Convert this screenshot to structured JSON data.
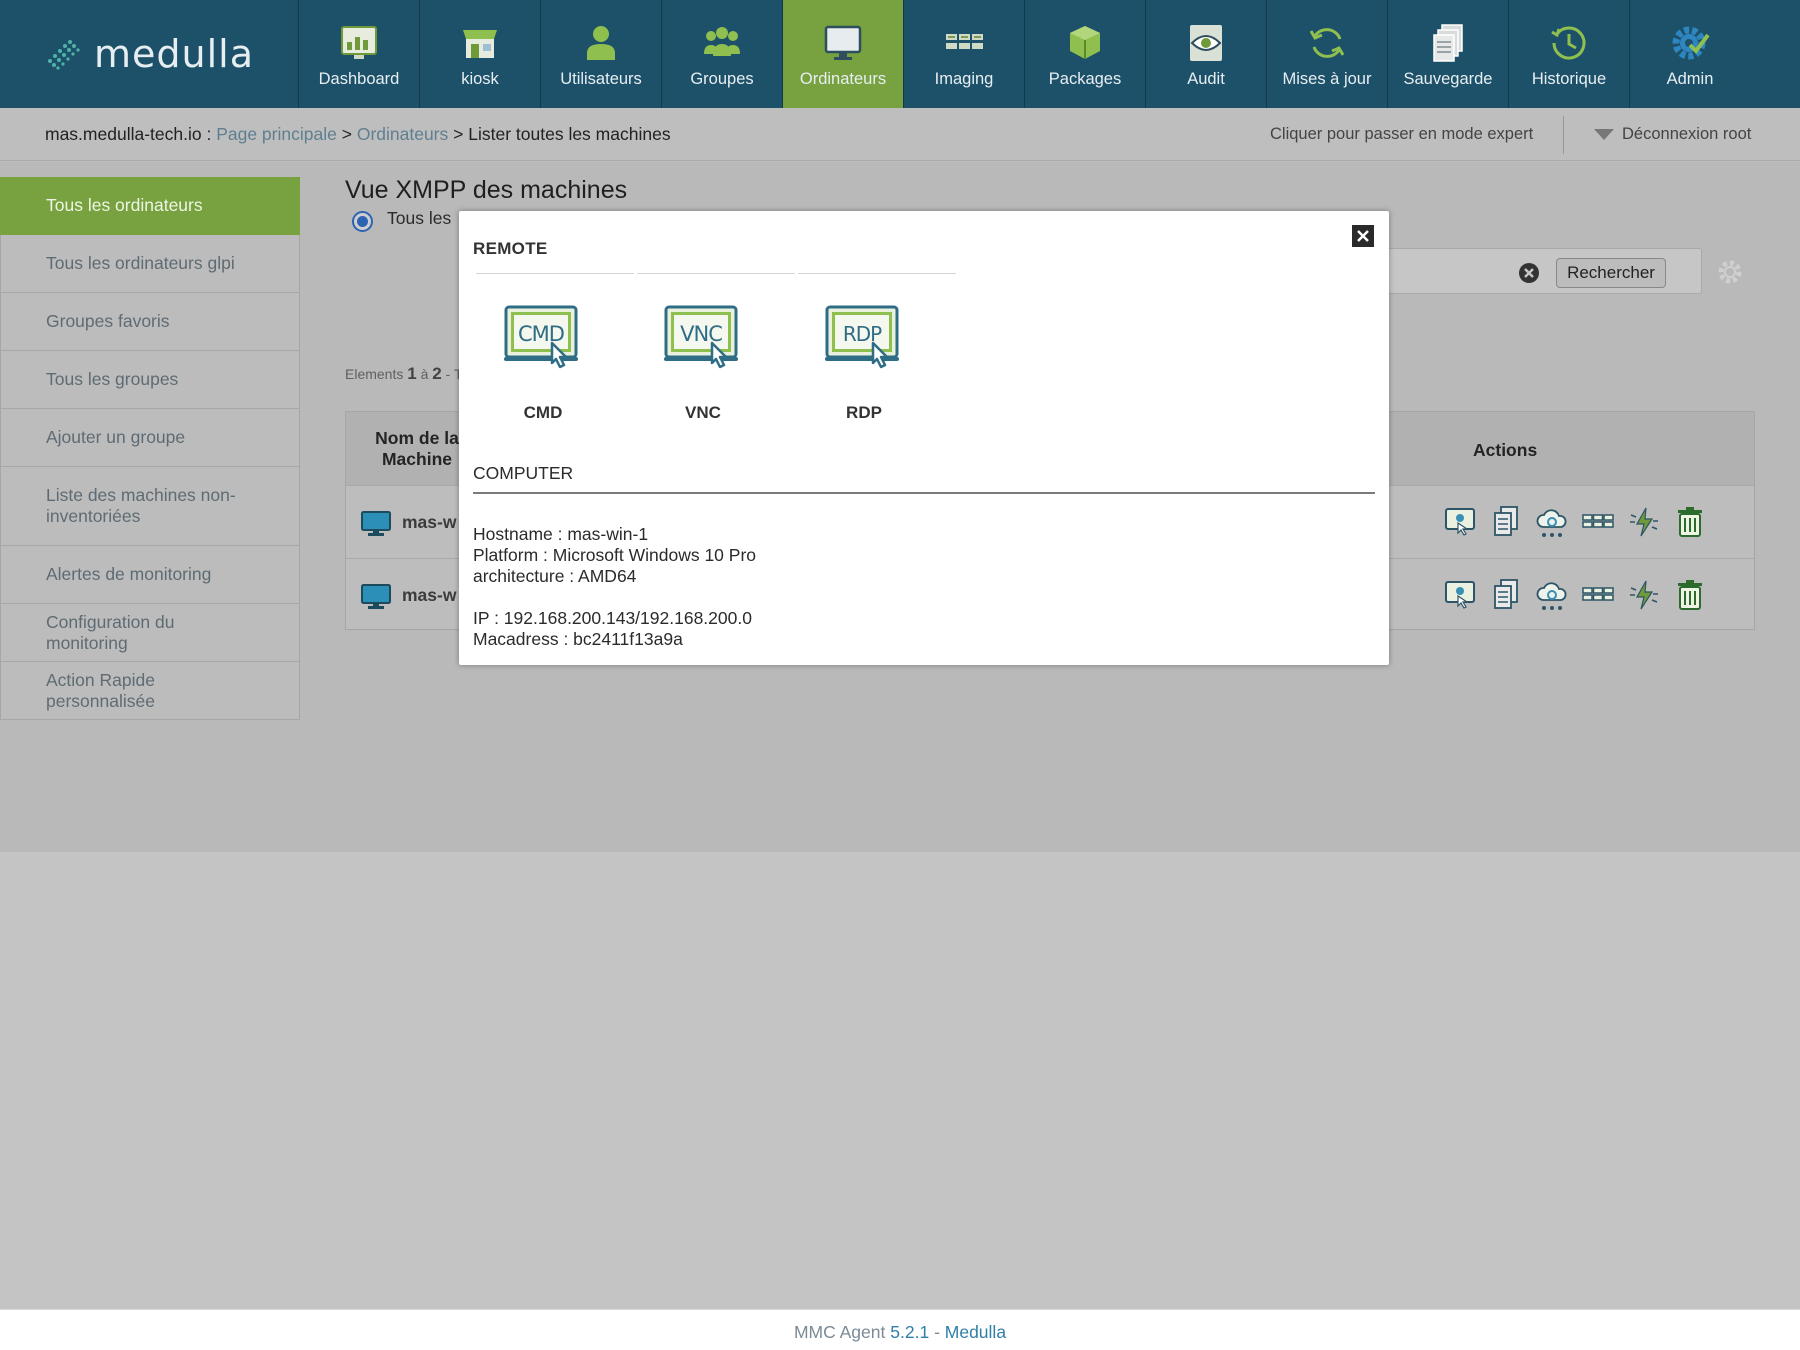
{
  "app": {
    "logo_text": "medulla"
  },
  "nav": [
    {
      "label": "Dashboard",
      "icon": "dashboard-icon"
    },
    {
      "label": "kiosk",
      "icon": "kiosk-icon"
    },
    {
      "label": "Utilisateurs",
      "icon": "user-icon"
    },
    {
      "label": "Groupes",
      "icon": "group-icon"
    },
    {
      "label": "Ordinateurs",
      "icon": "monitor-icon",
      "active": true
    },
    {
      "label": "Imaging",
      "icon": "imaging-icon"
    },
    {
      "label": "Packages",
      "icon": "packages-icon"
    },
    {
      "label": "Audit",
      "icon": "audit-eye-icon"
    },
    {
      "label": "Mises à jour",
      "icon": "refresh-icon"
    },
    {
      "label": "Sauvegarde",
      "icon": "backup-icon"
    },
    {
      "label": "Historique",
      "icon": "history-icon"
    },
    {
      "label": "Admin",
      "icon": "gear-check-icon"
    }
  ],
  "breadcrumb": {
    "host": "mas.medulla-tech.io :",
    "home": "Page principale",
    "sep": ">",
    "section": "Ordinateurs",
    "current": "Lister toutes les machines"
  },
  "header": {
    "expert_mode": "Cliquer pour passer en mode expert",
    "logout": "Déconnexion root"
  },
  "sidebar": {
    "items": [
      {
        "label": "Tous les ordinateurs",
        "active": true
      },
      {
        "label": "Tous les ordinateurs glpi"
      },
      {
        "label": "Groupes favoris"
      },
      {
        "label": "Tous les groupes"
      },
      {
        "label": "Ajouter un groupe"
      },
      {
        "label": "Liste des machines non-inventoriées"
      },
      {
        "label": "Alertes de monitoring"
      },
      {
        "label": "Configuration du monitoring"
      },
      {
        "label": "Action Rapide personnalisée"
      }
    ]
  },
  "main": {
    "title": "Vue XMPP des machines",
    "radio_label": "Tous les",
    "search_button": "Rechercher",
    "elements": {
      "prefix": "Elements",
      "from": "1",
      "sep": "à",
      "to": "2",
      "suffix": "- T"
    },
    "table": {
      "header_name": "Nom de la Machine",
      "header_actions": "Actions",
      "rows": [
        {
          "name": "mas-w"
        },
        {
          "name": "mas-w"
        }
      ]
    }
  },
  "modal": {
    "remote_title": "REMOTE",
    "remote_items": [
      {
        "label": "CMD",
        "icon_text": "CMD"
      },
      {
        "label": "VNC",
        "icon_text": "VNC"
      },
      {
        "label": "RDP",
        "icon_text": "RDP"
      }
    ],
    "computer_title": "COMPUTER",
    "info": {
      "hostname": "Hostname : mas-win-1",
      "platform": "Platform : Microsoft Windows 10 Pro",
      "architecture": "architecture : AMD64",
      "ip": "IP : 192.168.200.143/192.168.200.0",
      "mac": "Macadress : bc2411f13a9a"
    }
  },
  "footer": {
    "agent": "MMC Agent",
    "version": "5.2.1",
    "dash": "-",
    "brand": "Medulla"
  },
  "colors": {
    "nav_bg": "#1d5169",
    "accent_green": "#77a23f",
    "link": "#2f7fa8"
  }
}
